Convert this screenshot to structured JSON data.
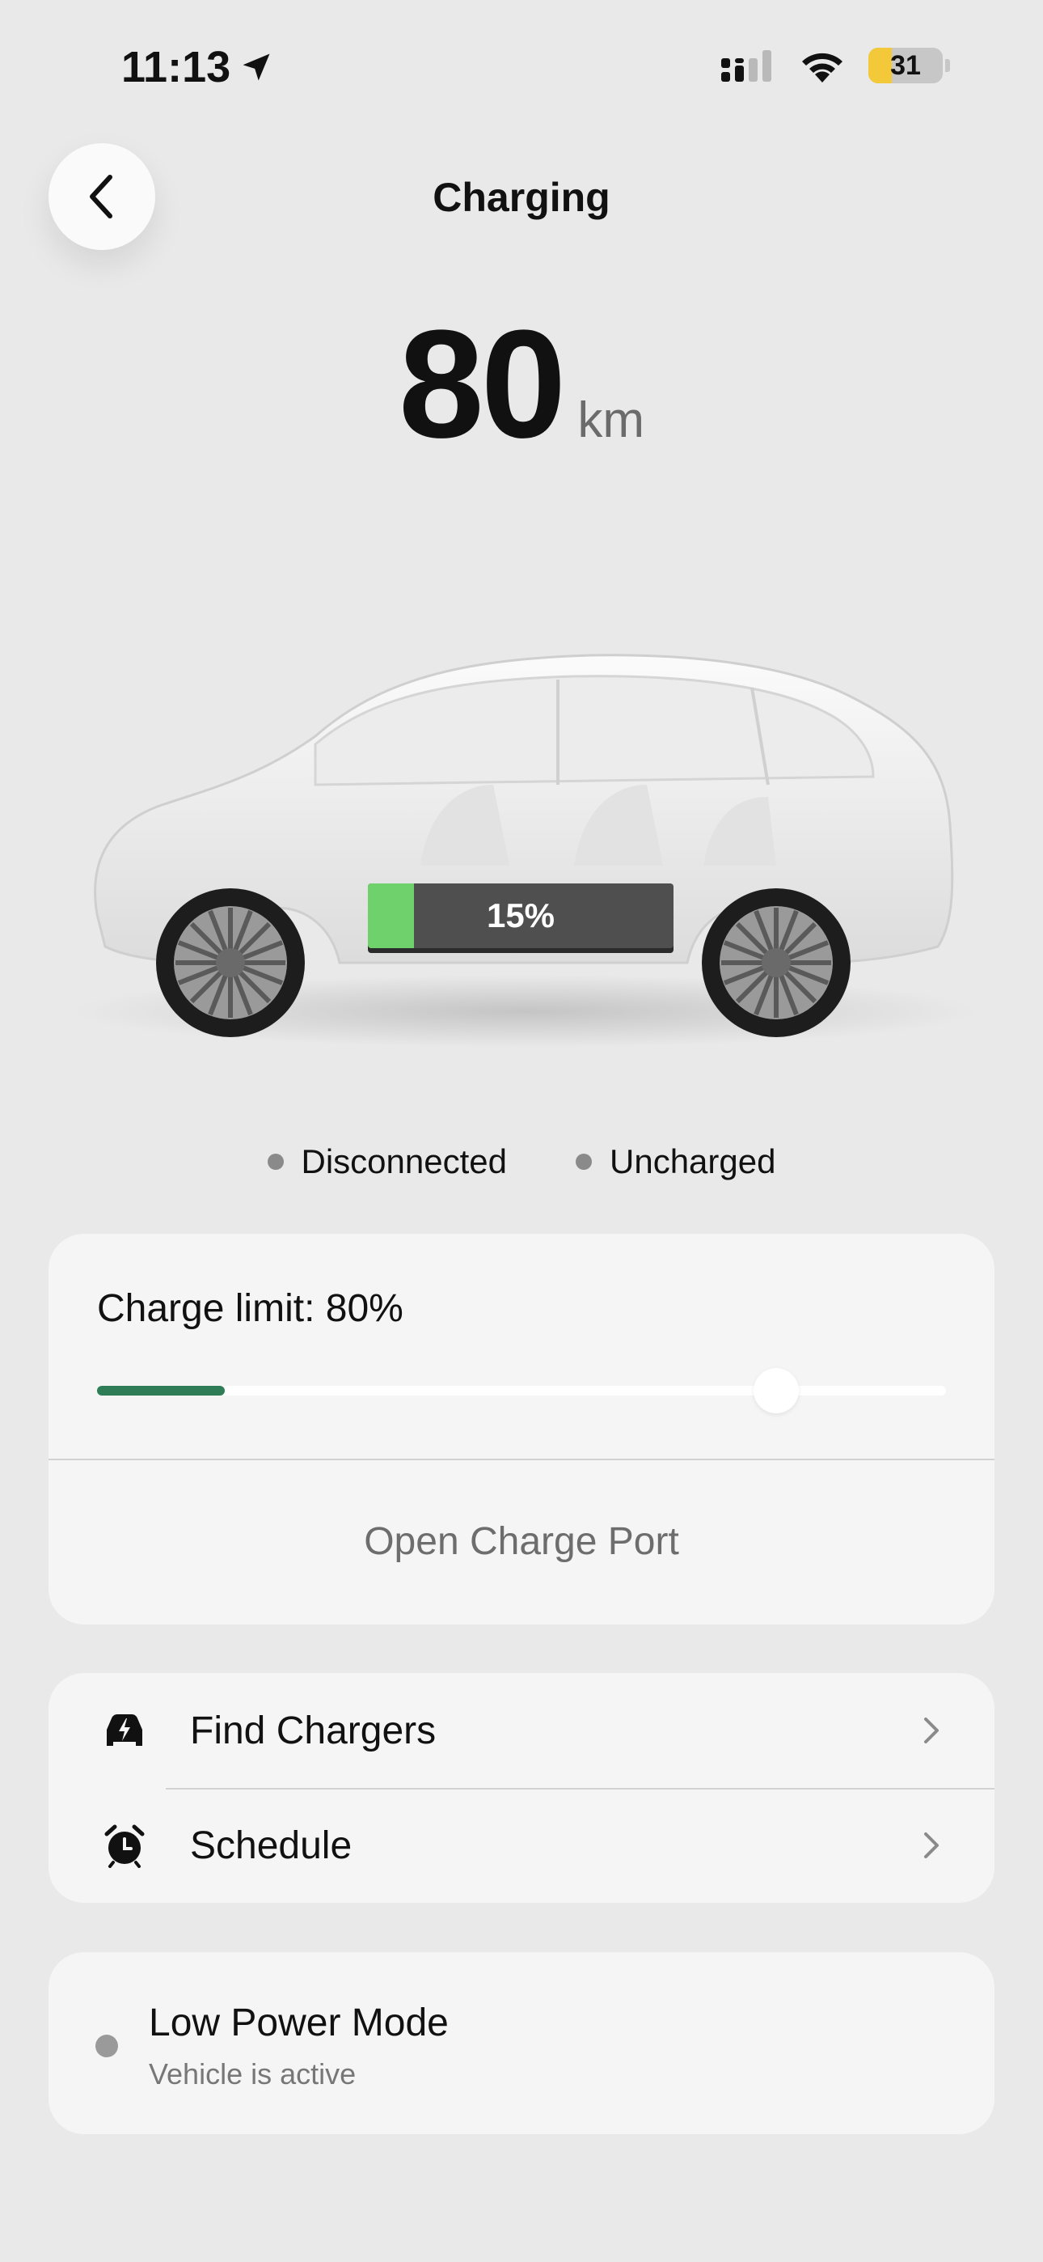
{
  "status_bar": {
    "time": "11:13",
    "battery_level": "31",
    "battery_fill_fraction": 0.31,
    "battery_color": "#f3c93a",
    "icons": [
      "location-arrow-icon",
      "cellular-signal-icon",
      "wifi-icon",
      "battery-icon"
    ]
  },
  "header": {
    "title": "Charging",
    "back_icon": "chevron-left-icon"
  },
  "range": {
    "value": "80",
    "unit": "km"
  },
  "vehicle": {
    "state_of_charge_label": "15%",
    "state_of_charge_fraction": 0.15,
    "charge_fill_color": "#6fd16b"
  },
  "status": {
    "connection": "Disconnected",
    "charging": "Uncharged"
  },
  "charge_card": {
    "limit_label": "Charge limit: 80%",
    "limit_fraction": 0.8,
    "current_fraction": 0.15,
    "fill_color": "#2e7d57",
    "open_port_label": "Open Charge Port"
  },
  "menu": {
    "items": [
      {
        "label": "Find Chargers",
        "icon": "car-charging-icon"
      },
      {
        "label": "Schedule",
        "icon": "alarm-clock-icon"
      }
    ]
  },
  "low_power": {
    "title": "Low Power Mode",
    "subtitle": "Vehicle is active"
  }
}
